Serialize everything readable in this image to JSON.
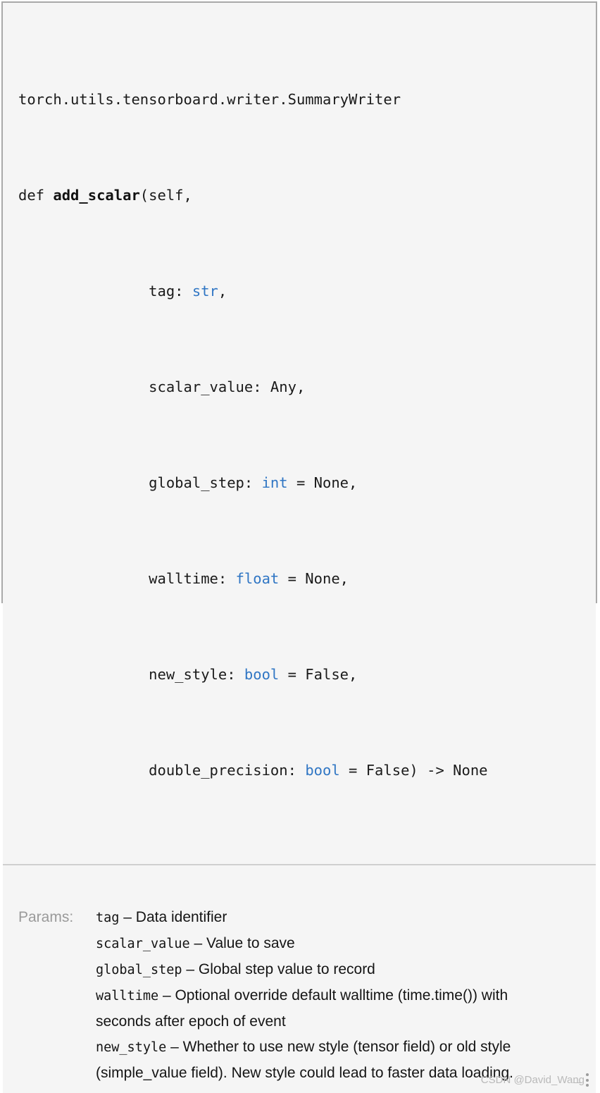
{
  "panel": {
    "kind": "documentation-tooltip",
    "background_color": "#f5f5f5",
    "border_color": "#a9a9a9",
    "divider_color": "#cfcfcf"
  },
  "signature": {
    "qualified_path": "torch.utils.tensorboard.writer.SummaryWriter",
    "keyword": "def",
    "function_name": "add_scalar",
    "open_paren": "(",
    "first_arg": "self,",
    "type_color": "#3076c4",
    "text_color": "#1a1a1a",
    "lines": [
      {
        "indent": "",
        "text": "torch.utils.tensorboard.writer.SummaryWriter"
      },
      {
        "indent": "",
        "text": "def add_scalar(self,"
      },
      {
        "indent": "               ",
        "text": "tag: str,"
      },
      {
        "indent": "               ",
        "text": "scalar_value: Any,"
      },
      {
        "indent": "               ",
        "text": "global_step: int = None,"
      },
      {
        "indent": "               ",
        "text": "walltime: float = None,"
      },
      {
        "indent": "               ",
        "text": "new_style: bool = False,"
      },
      {
        "indent": "               ",
        "text": "double_precision: bool = False) -> None"
      }
    ],
    "parts": {
      "line1": "torch.utils.tensorboard.writer.SummaryWriter",
      "line2_def": "def ",
      "line2_name": "add_scalar",
      "line2_rest": "(self,",
      "line3_indent": "               ",
      "line3_a": "tag: ",
      "line3_type": "str",
      "line3_b": ",",
      "line4_a": "scalar_value: Any,",
      "line5_a": "global_step: ",
      "line5_type": "int",
      "line5_b": " = None,",
      "line6_a": "walltime: ",
      "line6_type": "float",
      "line6_b": " = None,",
      "line7_a": "new_style: ",
      "line7_type": "bool",
      "line7_b": " = False,",
      "line8_a": "double_precision: ",
      "line8_type": "bool",
      "line8_b": " = False) -> None"
    }
  },
  "params": {
    "label": "Params:",
    "label_color": "#9a9a9a",
    "items": [
      {
        "name": "tag",
        "dash": " – ",
        "description": "Data identifier"
      },
      {
        "name": "scalar_value",
        "dash": " – ",
        "description": "Value to save"
      },
      {
        "name": "global_step",
        "dash": " – ",
        "description": "Global step value to record"
      },
      {
        "name": "walltime",
        "dash": " – ",
        "description": "Optional override default walltime (time.time()) with seconds after epoch of event"
      },
      {
        "name": "new_style",
        "dash": " – ",
        "description": "Whether to use new style (tensor field) or old style (simple_value field). New style could lead to faster data loading."
      }
    ]
  },
  "watermark": {
    "text": "CSDN @David_Wang",
    "color": "#b9b9b9",
    "icon": "more-vertical-icon"
  }
}
